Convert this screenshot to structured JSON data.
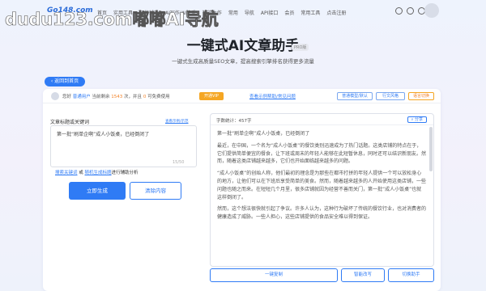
{
  "brand": {
    "logo_text": "Go148.com",
    "watermark": "dudu123.com嘟嘟AI导航"
  },
  "nav": {
    "links": [
      "首页",
      "实用工具",
      "写作辅助",
      "AI写作/AI降重",
      "智能生作",
      "常用",
      "导航",
      "API接口",
      "会员",
      "常用工具",
      "点击注册"
    ]
  },
  "hero": {
    "title": "一键式AI文章助手",
    "badge": "PRO版",
    "subtitle": "一键式生成高质量SEO文章，提高搜索引擎排名获得更多流量"
  },
  "back_label": "返回到首页",
  "topbar": {
    "user_prefix": "您好",
    "user_name": "普通用户",
    "user_mid": "当前剩余",
    "credits": "1543",
    "user_mid2": "次，并且",
    "vip_count": "0",
    "user_suffix": "可免费使用",
    "open_vip": "开通VIP",
    "guide": "查看示例帮助/常见问题",
    "btn_model": "普通模型/默认",
    "btn_style": "行文风格",
    "btn_lang": "语言切换"
  },
  "left": {
    "label": "文章标题或关键词",
    "hint": "查看示例/示范",
    "input_value": "第一批“刷单企啊”成人小饭桌，已经倒闭了",
    "counter": "15/50",
    "links_prefix": "",
    "link1": "搜索关键词",
    "links_mid": " 或 ",
    "link2": "随机生成标题",
    "links_suffix": "进行辅助分析",
    "generate": "立即生成",
    "clear": "清除内容"
  },
  "right": {
    "word_count_label": "字数统计：",
    "word_count": "457字",
    "share": "分享",
    "paragraphs": [
      "第一批“刷单企啊”成人小饭桌，已经倒闭了",
      "最近，在中国，一个名为“成人小饭桌”的餐饮类别迅速成为了热门话题。这类店铺的特点在于，它们提供简单便宜的餐食，让下班或周末的年轻人能够在此短暂休息，同时还可以结识新朋友。然而，随着这类店铺越来越多，它们也开始面临越来越多的问题。",
      "“成人小饭桌”的创始人称，他们最初的理念是为那些在都市打拼的年轻人提供一个可以放松身心的地方，让他们可以在下班后享受简单的美食。然而，随着越来越多的人开始使用这类店铺，一些问题也随之而来。在短短几个月里，很多店铺就因为经营不善而关门，第一批“成人小饭桌”也就这样倒闭了。",
      "然而，这个想法很快就引起了争议。许多人认为，这种行为破坏了传统的餐饮行业，也对消费者的健康造成了威胁。一些人担心，这些店铺提供的食品安全难以得到保证。"
    ]
  },
  "bottom": {
    "copy": "一键复制",
    "rewrite": "智能改写",
    "continue": "切换助手"
  }
}
